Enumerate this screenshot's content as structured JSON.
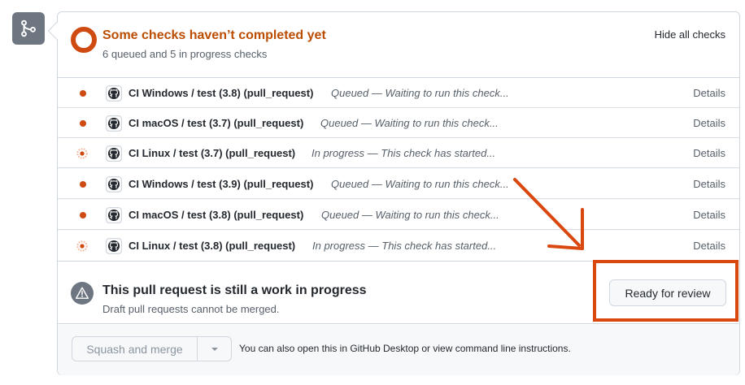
{
  "header": {
    "title": "Some checks haven’t completed yet",
    "subtitle": "6 queued and 5 in progress checks",
    "hide_label": "Hide all checks"
  },
  "checks": [
    {
      "status": "queued",
      "name": "CI Windows / test (3.8) (pull_request)",
      "desc": "Queued — Waiting to run this check...",
      "details": "Details"
    },
    {
      "status": "queued",
      "name": "CI macOS / test (3.7) (pull_request)",
      "desc": "Queued — Waiting to run this check...",
      "details": "Details"
    },
    {
      "status": "in_progress",
      "name": "CI Linux / test (3.7) (pull_request)",
      "desc": "In progress — This check has started...",
      "details": "Details"
    },
    {
      "status": "queued",
      "name": "CI Windows / test (3.9) (pull_request)",
      "desc": "Queued — Waiting to run this check...",
      "details": "Details"
    },
    {
      "status": "queued",
      "name": "CI macOS / test (3.8) (pull_request)",
      "desc": "Queued — Waiting to run this check...",
      "details": "Details"
    },
    {
      "status": "in_progress",
      "name": "CI Linux / test (3.8) (pull_request)",
      "desc": "In progress — This check has started...",
      "details": "Details"
    }
  ],
  "wip": {
    "title": "This pull request is still a work in progress",
    "subtitle": "Draft pull requests cannot be merged.",
    "ready_label": "Ready for review"
  },
  "merge": {
    "squash_label": "Squash and merge",
    "note_prefix": "You can also ",
    "desktop_link": "open this in GitHub Desktop",
    "note_middle": " or view ",
    "cli_link": "command line instructions",
    "note_suffix": "."
  },
  "colors": {
    "status_orange": "#bc4c00",
    "annotation_orange": "#d9480f"
  }
}
